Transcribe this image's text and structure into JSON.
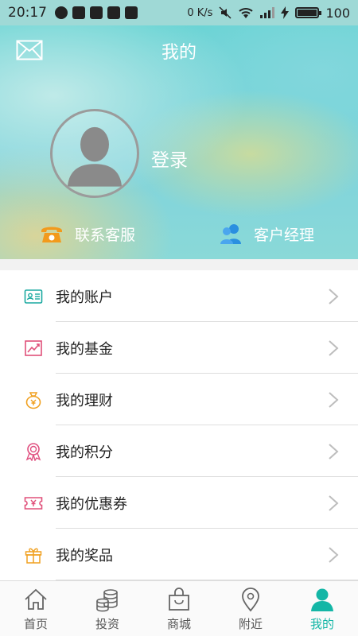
{
  "status_bar": {
    "time": "20:17",
    "net_speed": "0 K/s",
    "battery": "100",
    "battery_level": 1.0
  },
  "header": {
    "title": "我的",
    "login": "登录",
    "actions": [
      {
        "label": "联系客服",
        "icon": "phone-icon"
      },
      {
        "label": "客户经理",
        "icon": "users-icon"
      }
    ]
  },
  "menu": {
    "items": [
      {
        "label": "我的账户",
        "icon": "id-card-icon",
        "color": "#1aa9a0"
      },
      {
        "label": "我的基金",
        "icon": "trend-chart-icon",
        "color": "#e0507a"
      },
      {
        "label": "我的理财",
        "icon": "money-bag-icon",
        "color": "#f0a020"
      },
      {
        "label": "我的积分",
        "icon": "medal-icon",
        "color": "#e05080"
      },
      {
        "label": "我的优惠券",
        "icon": "coupon-icon",
        "color": "#e0507a"
      },
      {
        "label": "我的奖品",
        "icon": "gift-icon",
        "color": "#f0a020"
      }
    ]
  },
  "bottom_nav": {
    "items": [
      {
        "label": "首页",
        "icon": "home-icon"
      },
      {
        "label": "投资",
        "icon": "coins-icon"
      },
      {
        "label": "商城",
        "icon": "shopping-bag-icon"
      },
      {
        "label": "附近",
        "icon": "location-pin-icon"
      },
      {
        "label": "我的",
        "icon": "person-icon",
        "active": true
      }
    ],
    "active_color": "#14b6a6"
  }
}
